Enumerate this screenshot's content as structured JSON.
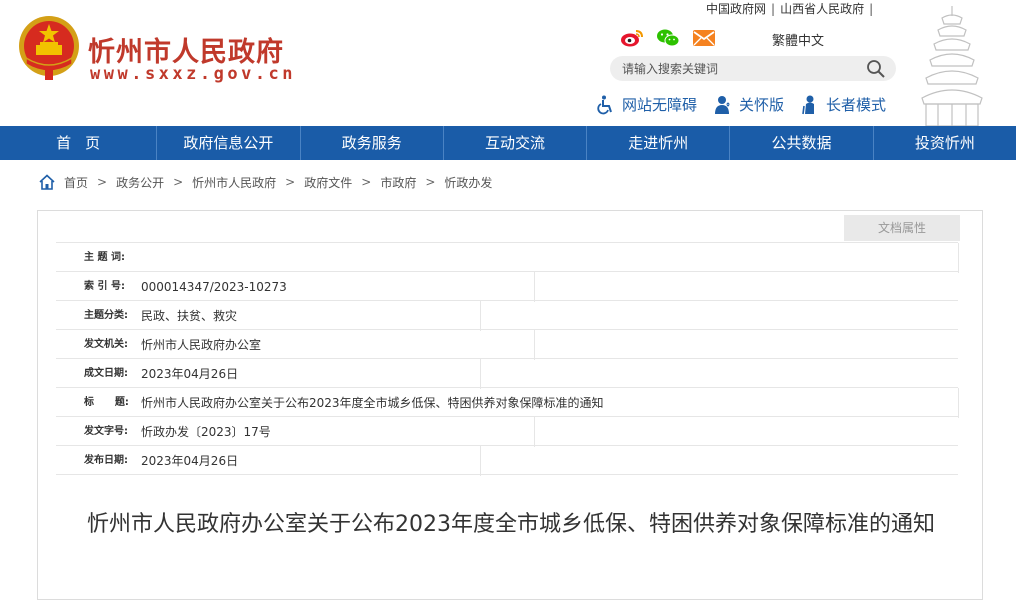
{
  "header": {
    "site_title": "忻州市人民政府",
    "site_url": "www.sxxz.gov.cn",
    "top_links": [
      "中国政府网",
      "山西省人民政府"
    ],
    "language_switch": "繁體中文",
    "search_placeholder": "请输入搜索关键词",
    "accessibility": [
      {
        "label": "网站无障碍",
        "icon": "wheelchair-icon"
      },
      {
        "label": "关怀版",
        "icon": "care-person-icon"
      },
      {
        "label": "长者模式",
        "icon": "elder-person-icon"
      }
    ],
    "social_icons": [
      "weibo-icon",
      "wechat-icon",
      "email-icon"
    ],
    "brand_color": "#c0392b"
  },
  "nav": {
    "color": "#1a5ca8",
    "items": [
      "首页",
      "政府信息公开",
      "政务服务",
      "互动交流",
      "走进忻州",
      "公共数据",
      "投资忻州"
    ]
  },
  "breadcrumb": [
    "首页",
    "政务公开",
    "忻州市人民政府",
    "政府文件",
    "市政府",
    "忻政办发"
  ],
  "doc_properties_label": "文档属性",
  "meta": [
    {
      "key": "主 题 词:",
      "value": ""
    },
    {
      "key": "索 引 号:",
      "value": "000014347/2023-10273"
    },
    {
      "key": "主题分类:",
      "value": "民政、扶贫、救灾"
    },
    {
      "key": "发文机关:",
      "value": "忻州市人民政府办公室"
    },
    {
      "key": "成文日期:",
      "value": "2023年04月26日"
    },
    {
      "key": "标      题:",
      "value": "忻州市人民政府办公室关于公布2023年度全市城乡低保、特困供养对象保障标准的通知"
    },
    {
      "key": "发文字号:",
      "value": "忻政办发〔2023〕17号"
    },
    {
      "key": "发布日期:",
      "value": "2023年04月26日"
    }
  ],
  "document_title": "忻州市人民政府办公室关于公布2023年度全市城乡低保、特困供养对象保障标准的通知"
}
